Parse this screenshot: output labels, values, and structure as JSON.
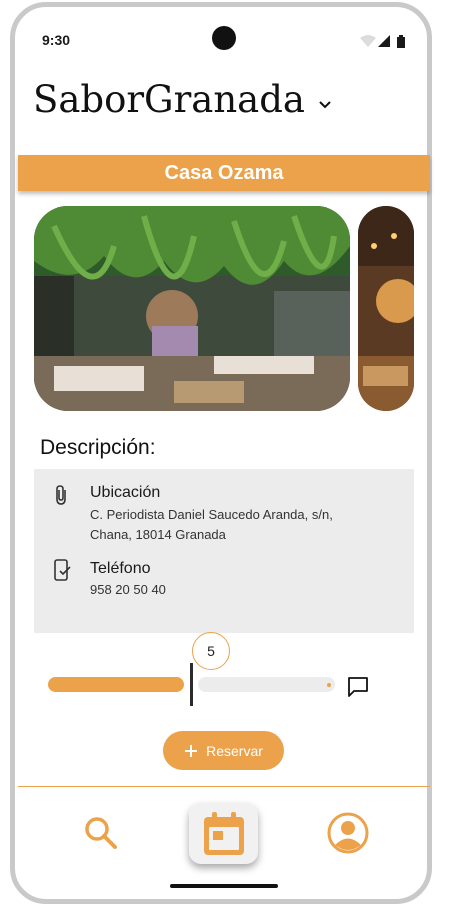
{
  "status": {
    "time": "9:30"
  },
  "header": {
    "brand": "SaborGranada"
  },
  "restaurant": {
    "name": "Casa Ozama"
  },
  "description": {
    "title": "Descripción:",
    "location_label": "Ubicación",
    "location_line1": "C. Periodista Daniel Saucedo Aranda, s/n,",
    "location_line2": "Chana, 18014 Granada",
    "phone_label": "Teléfono",
    "phone_value": "958 20 50 40"
  },
  "rating": {
    "value": "5",
    "fraction": 0.5
  },
  "actions": {
    "reserve_label": "Reservar"
  },
  "colors": {
    "accent": "#eba24a",
    "card": "#ececec"
  },
  "icons": [
    "chevron-down-icon",
    "paperclip-icon",
    "phone-check-icon",
    "comment-icon",
    "plus-icon",
    "search-icon",
    "calendar-icon",
    "profile-icon",
    "wifi-icon",
    "signal-icon",
    "battery-icon"
  ]
}
